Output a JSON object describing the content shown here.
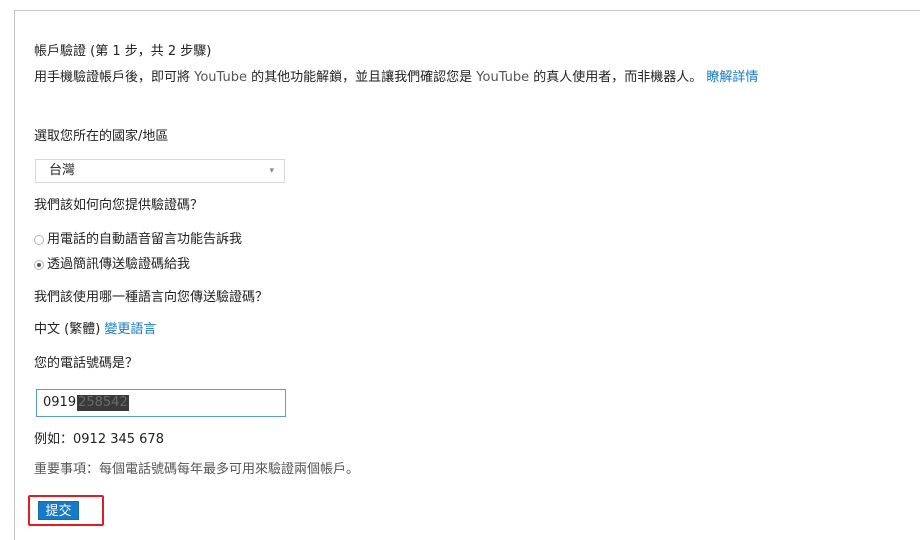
{
  "verification": {
    "title": "帳戶驗證 (第 1 步，共 2 步驟)",
    "description_pre": "用手機驗證帳戶後，即可將 ",
    "youtube_1": "YouTube",
    "description_mid": " 的其他功能解鎖，並且讓我們確認您是 ",
    "youtube_2": "YouTube",
    "description_post": " 的真人使用者，而非機器人。 ",
    "learn_more": "瞭解詳情"
  },
  "country": {
    "question": "選取您所在的國家/地區",
    "selected": "台灣",
    "arrow": "▾"
  },
  "method": {
    "question": "我們該如何向您提供驗證碼？",
    "options": [
      {
        "label": "用電話的自動語音留言功能告訴我",
        "checked": false
      },
      {
        "label": "透過簡訊傳送驗證碼給我",
        "checked": true
      }
    ]
  },
  "language": {
    "question": "我們該使用哪一種語言向您傳送驗證碼？",
    "current": "中文 (繁體)",
    "change_link": "變更語言"
  },
  "phone": {
    "question": "您的電話號碼是？",
    "value_visible": "0919",
    "value_redacted": "258542",
    "example": "例如：0912 345 678",
    "note": "重要事項：每個電話號碼每年最多可用來驗證兩個帳戶。"
  },
  "submit": {
    "label": "提交"
  },
  "colors": {
    "link": "#167ac6",
    "button": "#167ac6",
    "highlight": "#e31b23"
  }
}
